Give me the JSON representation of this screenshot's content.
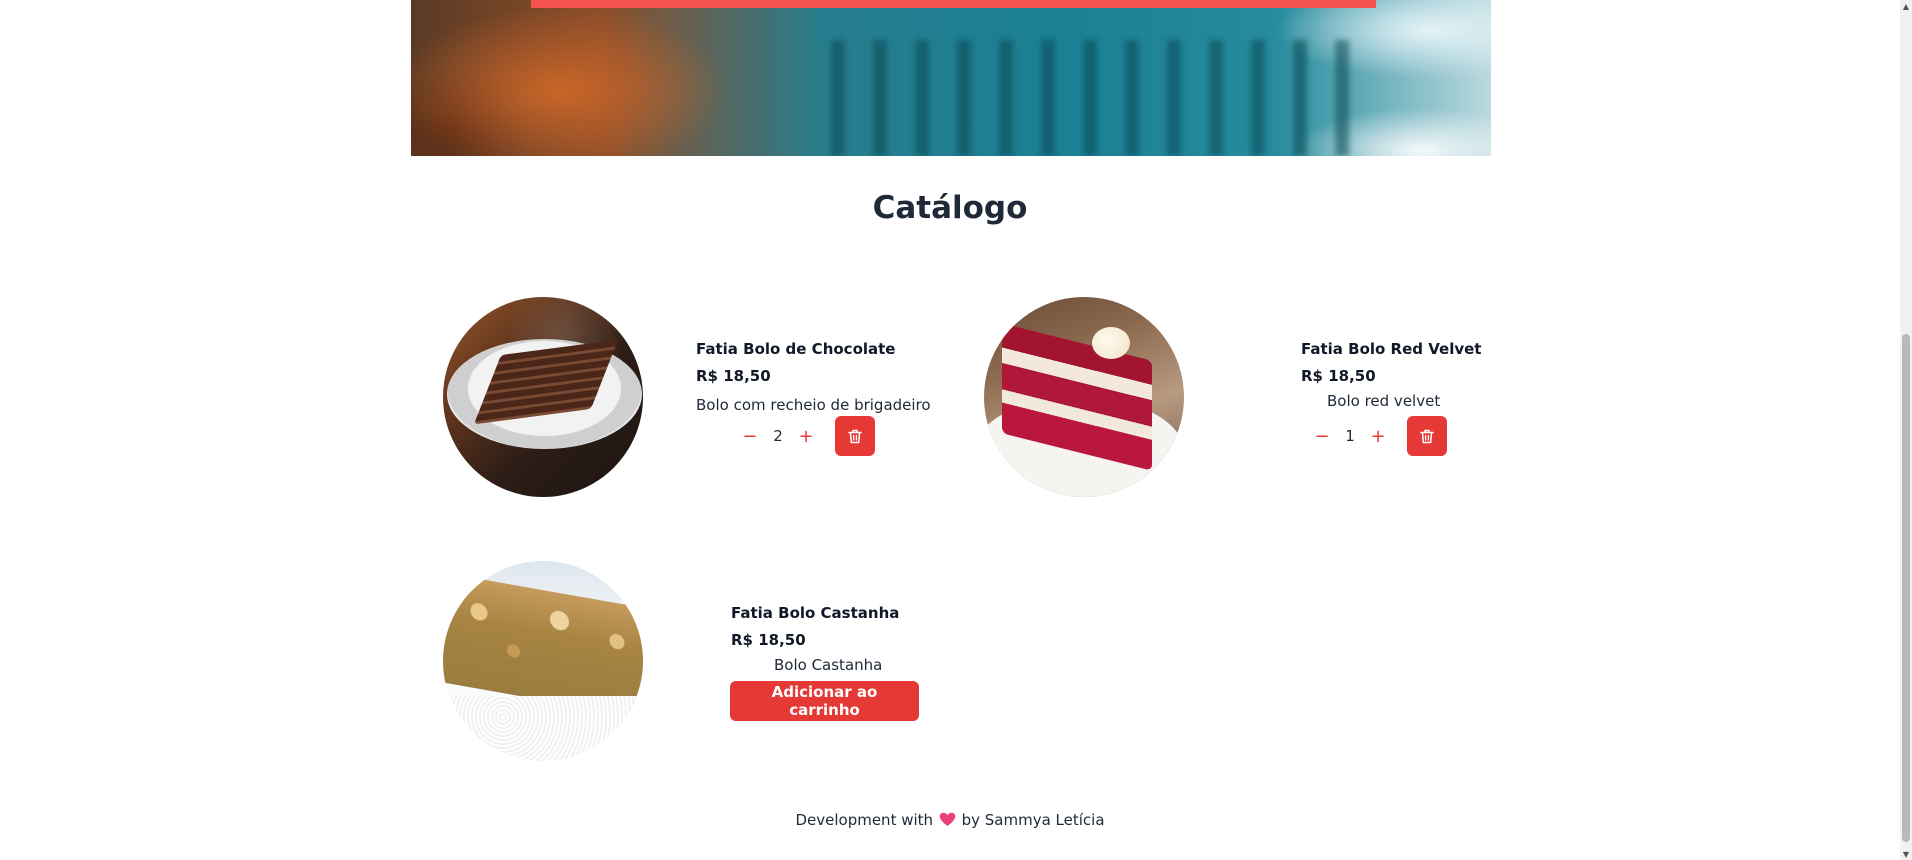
{
  "catalog": {
    "title": "Catálogo",
    "products": [
      {
        "name": "Fatia Bolo de Chocolate",
        "price": "R$ 18,50",
        "description": "Bolo com recheio de brigadeiro",
        "quantity": "2",
        "decrease_symbol": "−",
        "increase_symbol": "+"
      },
      {
        "name": "Fatia Bolo Red Velvet",
        "price": "R$ 18,50",
        "description": "Bolo red velvet",
        "quantity": "1",
        "decrease_symbol": "−",
        "increase_symbol": "+"
      },
      {
        "name": "Fatia Bolo Castanha",
        "price": "R$ 18,50",
        "description": "Bolo Castanha",
        "add_button_label": "Adicionar ao carrinho"
      }
    ]
  },
  "footer": {
    "text_before": "Development with",
    "text_after": "by Sammya Letícia",
    "heart_icon": "heart-icon"
  },
  "colors": {
    "accent": "#e53935",
    "text": "#1f2937",
    "banner_bar": "#ef5350"
  },
  "icons": {
    "trash": "trash-icon",
    "minus": "minus-icon",
    "plus": "plus-icon"
  }
}
